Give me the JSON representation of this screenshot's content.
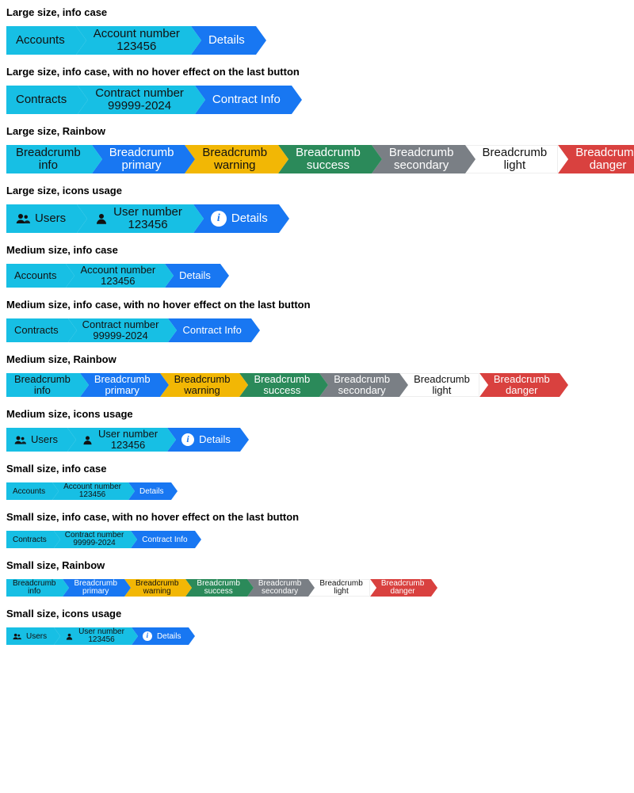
{
  "colors": {
    "info": "#17bfe4",
    "primary": "#1877f2",
    "warning": "#f2b705",
    "success": "#2b8a5a",
    "secondary": "#7a7f85",
    "light": "#ffffff",
    "danger": "#d9413f"
  },
  "sections": {
    "large_info": {
      "title": "Large size, info case",
      "items": [
        "Accounts",
        "Account number\n123456",
        "Details"
      ]
    },
    "large_info_nohover": {
      "title": "Large size, info case, with no hover effect on the last button",
      "items": [
        "Contracts",
        "Contract number\n99999-2024",
        "Contract Info"
      ]
    },
    "large_rainbow": {
      "title": "Large size, Rainbow",
      "items": [
        "Breadcrumb\ninfo",
        "Breadcrumb\nprimary",
        "Breadcrumb\nwarning",
        "Breadcrumb\nsuccess",
        "Breadcrumb\nsecondary",
        "Breadcrumb\nlight",
        "Breadcrumb\ndanger"
      ]
    },
    "large_icons": {
      "title": "Large size, icons usage",
      "items": [
        "Users",
        "User number\n123456",
        "Details"
      ]
    },
    "medium_info": {
      "title": "Medium size, info case",
      "items": [
        "Accounts",
        "Account number\n123456",
        "Details"
      ]
    },
    "medium_info_nohover": {
      "title": "Medium size, info case, with no hover effect on the last button",
      "items": [
        "Contracts",
        "Contract number\n99999-2024",
        "Contract Info"
      ]
    },
    "medium_rainbow": {
      "title": "Medium size, Rainbow",
      "items": [
        "Breadcrumb\ninfo",
        "Breadcrumb\nprimary",
        "Breadcrumb\nwarning",
        "Breadcrumb\nsuccess",
        "Breadcrumb\nsecondary",
        "Breadcrumb\nlight",
        "Breadcrumb\ndanger"
      ]
    },
    "medium_icons": {
      "title": "Medium size, icons usage",
      "items": [
        "Users",
        "User number\n123456",
        "Details"
      ]
    },
    "small_info": {
      "title": "Small size, info case",
      "items": [
        "Accounts",
        "Account number\n123456",
        "Details"
      ]
    },
    "small_info_nohover": {
      "title": "Small size, info case, with no hover effect on the last button",
      "items": [
        "Contracts",
        "Contract number\n99999-2024",
        "Contract Info"
      ]
    },
    "small_rainbow": {
      "title": "Small size, Rainbow",
      "items": [
        "Breadcrumb\ninfo",
        "Breadcrumb\nprimary",
        "Breadcrumb\nwarning",
        "Breadcrumb\nsuccess",
        "Breadcrumb\nsecondary",
        "Breadcrumb\nlight",
        "Breadcrumb\ndanger"
      ]
    },
    "small_icons": {
      "title": "Small size, icons usage",
      "items": [
        "Users",
        "User number\n123456",
        "Details"
      ]
    }
  }
}
